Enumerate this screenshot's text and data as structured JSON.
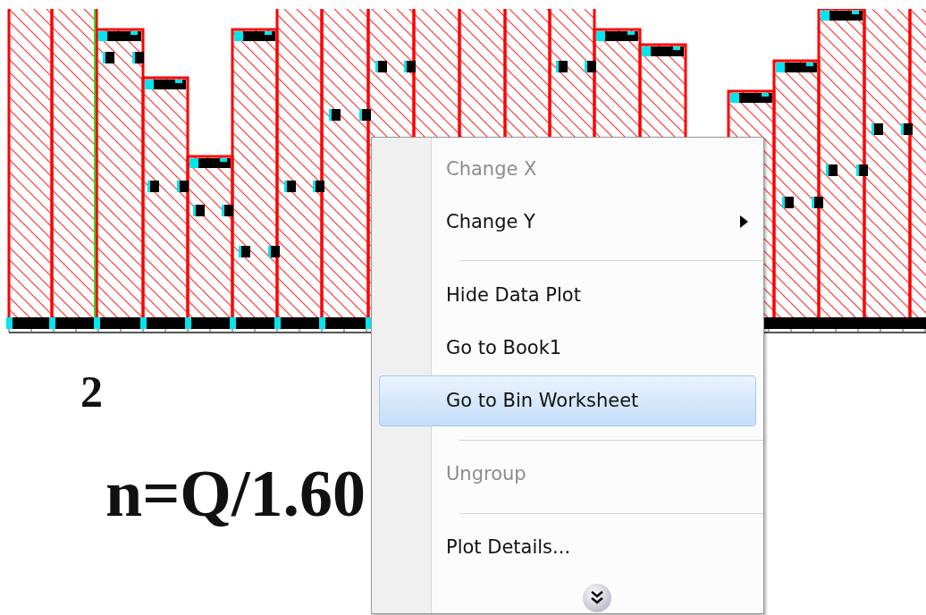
{
  "labels": [
    {
      "text": "2"
    },
    {
      "text": "n=Q/1.60"
    }
  ],
  "context_menu": {
    "items": [
      {
        "kind": "item",
        "label": "Change X",
        "disabled": true,
        "submenu": false,
        "selected": false
      },
      {
        "kind": "item",
        "label": "Change Y",
        "disabled": false,
        "submenu": true,
        "selected": false
      },
      {
        "kind": "separator"
      },
      {
        "kind": "item",
        "label": "Hide Data Plot",
        "disabled": false,
        "submenu": false,
        "selected": false
      },
      {
        "kind": "item",
        "label": "Go to Book1",
        "disabled": false,
        "submenu": false,
        "selected": false
      },
      {
        "kind": "item",
        "label": "Go to Bin Worksheet",
        "disabled": false,
        "submenu": false,
        "selected": true
      },
      {
        "kind": "separator"
      },
      {
        "kind": "item",
        "label": "Ungroup",
        "disabled": true,
        "submenu": false,
        "selected": false
      },
      {
        "kind": "separator"
      },
      {
        "kind": "item",
        "label": "Plot Details...",
        "disabled": false,
        "submenu": false,
        "selected": false
      },
      {
        "kind": "expand"
      }
    ]
  }
}
